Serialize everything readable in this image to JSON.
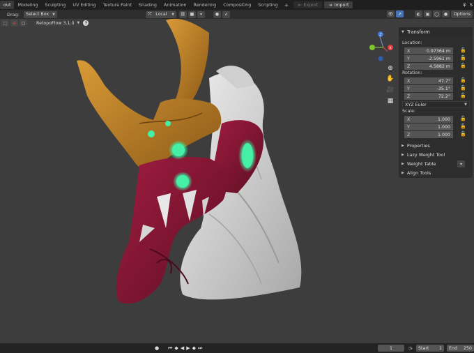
{
  "workspace_tabs": [
    "out",
    "Modeling",
    "Sculpting",
    "UV Editing",
    "Texture Paint",
    "Shading",
    "Animation",
    "Rendering",
    "Compositing",
    "Scripting"
  ],
  "active_tab_index": 0,
  "add_tab_symbol": "+",
  "export_label": "Export",
  "import_label": "Import",
  "top_right_text": "S",
  "header": {
    "drag_label": "Drag:",
    "select_mode": "Select Box",
    "transform_orientation": "Local",
    "options_label": "Options"
  },
  "retopoflow_label": "RetopoFlow 3.1.0",
  "help_symbol": "?",
  "npanel": {
    "transform_title": "Transform",
    "location_label": "Location:",
    "location": [
      {
        "axis": "X",
        "value": "0.97364 m"
      },
      {
        "axis": "Y",
        "value": "-2.5961 m"
      },
      {
        "axis": "Z",
        "value": "4.5882 m"
      }
    ],
    "rotation_label": "Rotation:",
    "rotation": [
      {
        "axis": "X",
        "value": "47.7°"
      },
      {
        "axis": "Y",
        "value": "-35.1°"
      },
      {
        "axis": "Z",
        "value": "72.2°"
      }
    ],
    "rotation_mode": "XYZ Euler",
    "scale_label": "Scale:",
    "scale": [
      {
        "axis": "X",
        "value": "1.000"
      },
      {
        "axis": "Y",
        "value": "1.000"
      },
      {
        "axis": "Z",
        "value": "1.000"
      }
    ],
    "sections": [
      "Properties",
      "Lazy Weight Tool",
      "Weight Table",
      "Align Tools"
    ]
  },
  "gizmo": {
    "x": "X",
    "y": "Y",
    "z": "Z"
  },
  "timeline": {
    "current_frame": "1",
    "start_label": "Start",
    "start_value": "1",
    "end_label": "End",
    "end_value": "250"
  },
  "colors": {
    "accent_blue": "#4772b3",
    "armor_gold": "#c6862a",
    "armor_red": "#8a1634",
    "glow_green": "#3ee89c",
    "body_white": "#d9d9d9"
  }
}
